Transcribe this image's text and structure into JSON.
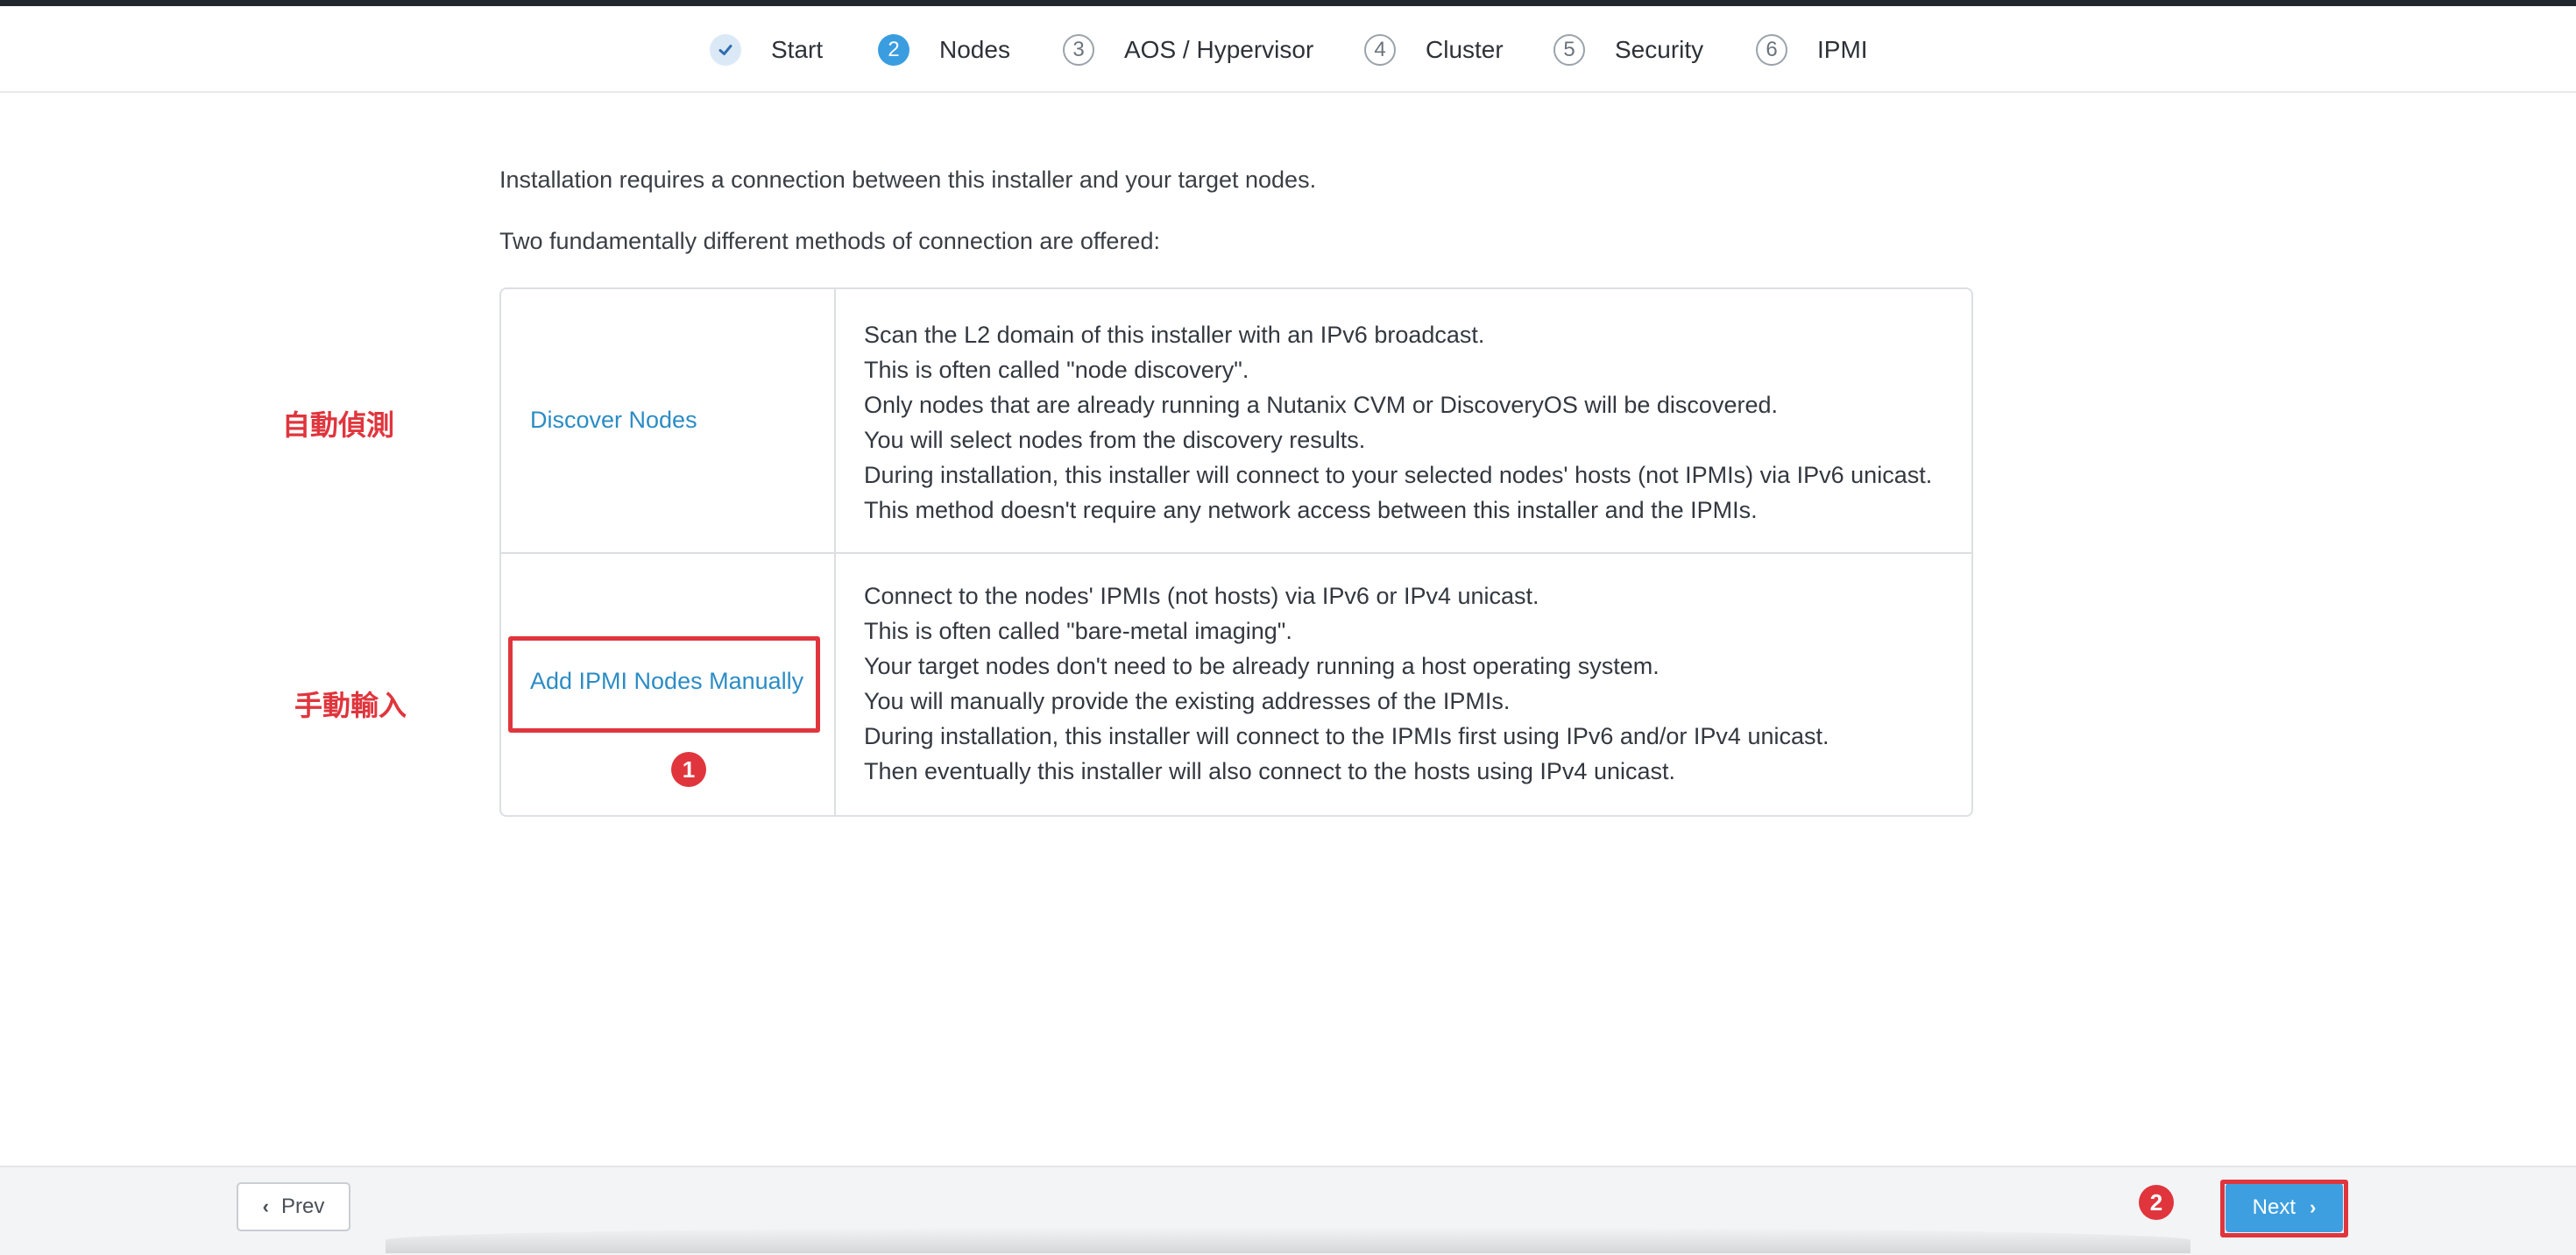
{
  "stepper": {
    "steps": [
      {
        "number": "✓",
        "label": "Start",
        "state": "done"
      },
      {
        "number": "2",
        "label": "Nodes",
        "state": "active"
      },
      {
        "number": "3",
        "label": "AOS / Hypervisor",
        "state": "todo"
      },
      {
        "number": "4",
        "label": "Cluster",
        "state": "todo"
      },
      {
        "number": "5",
        "label": "Security",
        "state": "todo"
      },
      {
        "number": "6",
        "label": "IPMI",
        "state": "todo"
      }
    ]
  },
  "intro": {
    "line1": "Installation requires a connection between this installer and your target nodes.",
    "line2": "Two fundamentally different methods of connection are offered:"
  },
  "methods": [
    {
      "link": "Discover Nodes",
      "annotation": "自動偵測",
      "description": [
        "Scan the L2 domain of this installer with an IPv6 broadcast.",
        "This is often called \"node discovery\".",
        "Only nodes that are already running a Nutanix CVM or DiscoveryOS will be discovered.",
        "You will select nodes from the discovery results.",
        "During installation, this installer will connect to your selected nodes' hosts (not IPMIs) via IPv6 unicast.",
        "This method doesn't require any network access between this installer and the IPMIs."
      ]
    },
    {
      "link": "Add IPMI Nodes Manually",
      "annotation": "手動輸入",
      "description": [
        "Connect to the nodes' IPMIs (not hosts) via IPv6 or IPv4 unicast.",
        "This is often called \"bare-metal imaging\".",
        "Your target nodes don't need to be already running a host operating system.",
        "You will manually provide the existing addresses of the IPMIs.",
        "During installation, this installer will connect to the IPMIs first using IPv6 and/or IPv4 unicast.",
        "Then eventually this installer will also connect to the hosts using IPv4 unicast."
      ]
    }
  ],
  "markers": {
    "badge1": "1",
    "badge2": "2"
  },
  "footer": {
    "prev_label": "Prev",
    "next_label": "Next"
  },
  "colors": {
    "accent": "#3a9de0",
    "link": "#2b8cc4",
    "annotation": "#e0353d"
  },
  "icons": {
    "step_done": "check-icon",
    "prev": "chevron-left-icon",
    "next": "chevron-right-icon"
  }
}
